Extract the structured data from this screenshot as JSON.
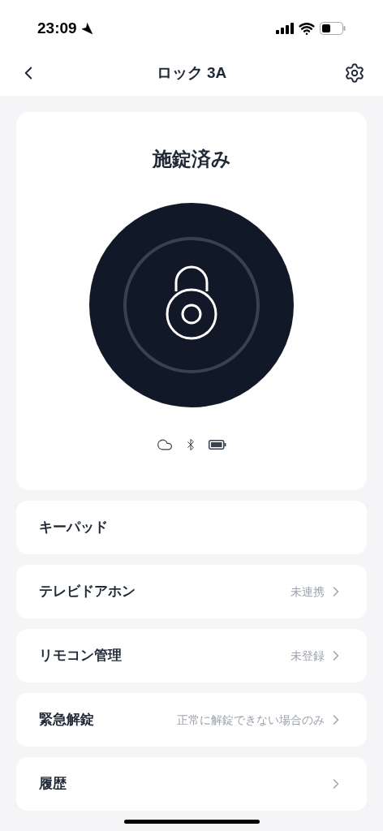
{
  "status_bar": {
    "time": "23:09"
  },
  "nav": {
    "title": "ロック 3A"
  },
  "lock_card": {
    "status": "施錠済み"
  },
  "menu": [
    {
      "label": "キーパッド",
      "chevron": false
    },
    {
      "label": "テレビドアホン",
      "value": "未連携",
      "chevron": true
    },
    {
      "label": "リモコン管理",
      "value": "未登録",
      "chevron": true
    },
    {
      "label": "緊急解錠",
      "value": "正常に解錠できない場合のみ",
      "chevron": true
    },
    {
      "label": "履歴",
      "chevron": true
    }
  ]
}
